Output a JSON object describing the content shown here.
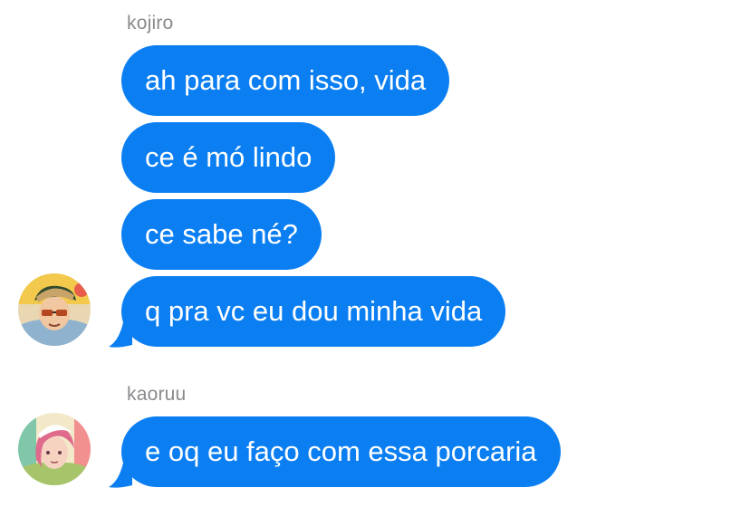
{
  "colors": {
    "bubble": "#0b7ff2",
    "bubble_text": "#ffffff",
    "sender_text": "#8a8a8e",
    "background": "#ffffff"
  },
  "groups": [
    {
      "sender": "kojiro",
      "avatar": "kojiro-avatar",
      "messages": [
        "ah para com isso, vida",
        "ce é mó lindo",
        "ce sabe né?",
        "q pra vc eu dou minha vida"
      ]
    },
    {
      "sender": "kaoruu",
      "avatar": "kaoruu-avatar",
      "messages": [
        "e oq eu faço com essa porcaria"
      ]
    }
  ]
}
